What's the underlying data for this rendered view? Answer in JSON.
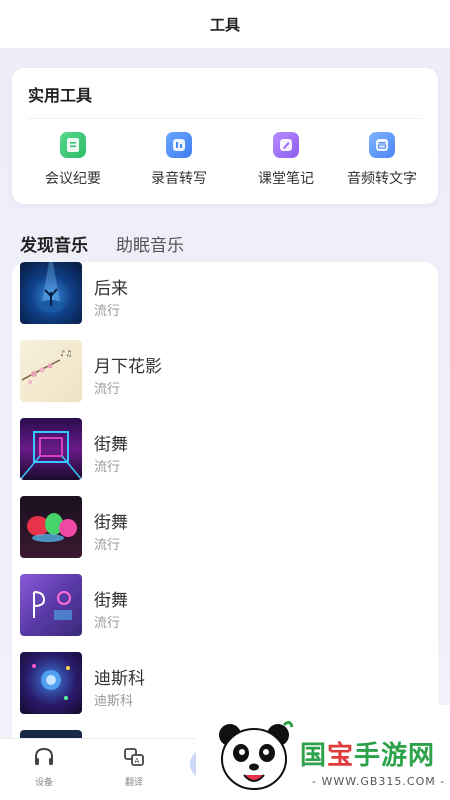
{
  "header": {
    "title": "工具"
  },
  "tools": {
    "title": "实用工具",
    "items": [
      {
        "label": "会议纪要",
        "icon": "meeting-notes-icon",
        "color": "#38c172"
      },
      {
        "label": "录音转写",
        "icon": "recording-transcribe-icon",
        "color": "#4a88f5"
      },
      {
        "label": "课堂笔记",
        "icon": "class-notes-icon",
        "color": "#9a6cf5"
      },
      {
        "label": "音频转文字",
        "icon": "audio-to-text-icon",
        "color": "#5690f5"
      }
    ]
  },
  "music_tabs": [
    {
      "label": "发现音乐",
      "active": true
    },
    {
      "label": "助眠音乐",
      "active": false
    }
  ],
  "music_list": [
    {
      "name": "后来",
      "category": "流行",
      "thumb": "night-tree-thumbnail"
    },
    {
      "name": "月下花影",
      "category": "流行",
      "thumb": "blossom-thumbnail"
    },
    {
      "name": "街舞",
      "category": "流行",
      "thumb": "neon-tunnel-thumbnail"
    },
    {
      "name": "街舞",
      "category": "流行",
      "thumb": "graffiti-thumbnail"
    },
    {
      "name": "街舞",
      "category": "流行",
      "thumb": "neon-room-thumbnail"
    },
    {
      "name": "迪斯科",
      "category": "迪斯科",
      "thumb": "disco-thumbnail"
    }
  ],
  "bottom_nav": [
    {
      "label": "设备",
      "icon": "headphones-icon"
    },
    {
      "label": "翻译",
      "icon": "translate-icon"
    }
  ],
  "watermark": {
    "brand_green": "国",
    "brand_red": "宝",
    "brand_rest": "手游网",
    "url": "- WWW.GB315.COM -"
  }
}
